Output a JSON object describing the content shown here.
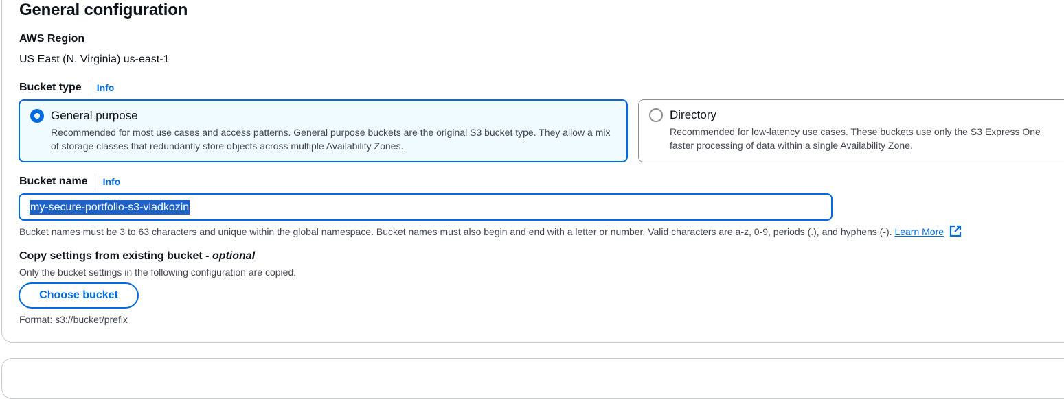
{
  "section": {
    "title": "General configuration"
  },
  "region": {
    "label": "AWS Region",
    "value": "US East (N. Virginia) us-east-1"
  },
  "bucket_type": {
    "label": "Bucket type",
    "info": "Info",
    "options": [
      {
        "title": "General purpose",
        "description": "Recommended for most use cases and access patterns. General purpose buckets are the original S3 bucket type. They allow a mix of storage classes that redundantly store objects across multiple Availability Zones.",
        "selected": true
      },
      {
        "title": "Directory",
        "description_line1": "Recommended for low-latency use cases. These buckets use only the S3 Express One",
        "description_line2": "faster processing of data within a single Availability Zone.",
        "selected": false
      }
    ]
  },
  "bucket_name": {
    "label": "Bucket name",
    "info": "Info",
    "value": "my-secure-portfolio-s3-vladkozin",
    "hint": "Bucket names must be 3 to 63 characters and unique within the global namespace. Bucket names must also begin and end with a letter or number. Valid characters are a-z, 0-9, periods (.), and hyphens (-).",
    "learn_more": "Learn More"
  },
  "copy_settings": {
    "title": "Copy settings from existing bucket - ",
    "optional": "optional",
    "description": "Only the bucket settings in the following configuration are copied.",
    "button": "Choose bucket",
    "format": "Format: s3://bucket/prefix"
  },
  "colors": {
    "accent": "#006ce0",
    "selected_tile_bg": "#f0fbff",
    "text_secondary": "#424650",
    "selection_highlight": "#1f62c7"
  },
  "icons": {
    "learn_more": "external-link-icon"
  }
}
